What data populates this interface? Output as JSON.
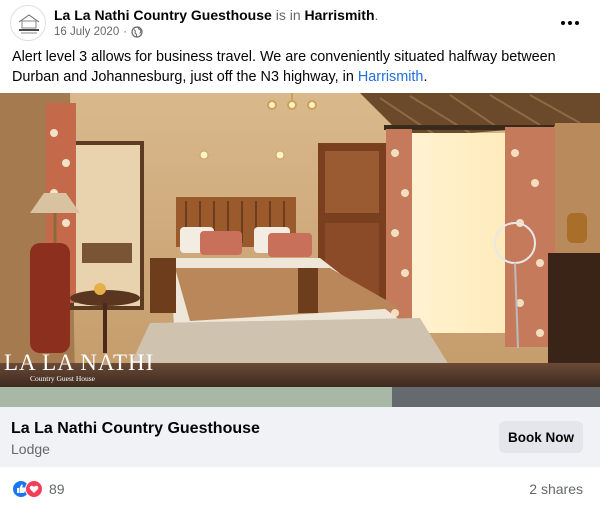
{
  "post": {
    "page_name": "La La Nathi Country Guesthouse",
    "is_in": "is in",
    "location": "Harrismith",
    "location_suffix": ".",
    "date": "16 July 2020",
    "separator": "·",
    "privacy_icon": "globe-icon",
    "more_icon": "more-options-icon",
    "text_before": "Alert level 3 allows for business travel. We are conveniently situated halfway between Durban and Johannesburg, just off the N3 highway, in ",
    "text_link": "Harrismith",
    "text_after": "."
  },
  "photo": {
    "watermark_title": "LA LA NATHI",
    "watermark_subtitle": "Country Guest House",
    "progress_fraction": 0.653
  },
  "link_card": {
    "title": "La La Nathi Country Guesthouse",
    "subtitle": "Lodge",
    "button_label": "Book Now"
  },
  "footer": {
    "reaction_icons": [
      "like-icon",
      "love-icon"
    ],
    "reaction_count": "89",
    "shares": "2 shares"
  },
  "colors": {
    "link": "#216fdb",
    "like": "#1877f2",
    "love": "#f33e58",
    "muted": "#65676b"
  }
}
